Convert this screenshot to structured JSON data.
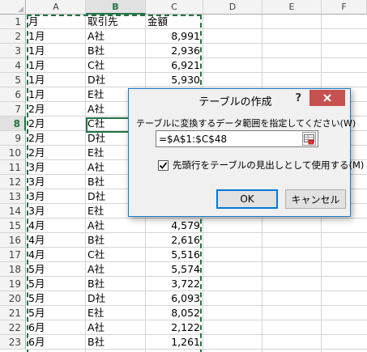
{
  "sheet": {
    "columns": [
      "A",
      "B",
      "C",
      "D",
      "E",
      "F"
    ],
    "selected_column": "B",
    "selected_row": "8",
    "rows": [
      {
        "n": "1",
        "a": "月",
        "b": "取引先",
        "c": "金額"
      },
      {
        "n": "2",
        "a": "1月",
        "b": "A社",
        "c": "8,991"
      },
      {
        "n": "3",
        "a": "1月",
        "b": "B社",
        "c": "2,936"
      },
      {
        "n": "4",
        "a": "1月",
        "b": "C社",
        "c": "6,921"
      },
      {
        "n": "5",
        "a": "1月",
        "b": "D社",
        "c": "5,930"
      },
      {
        "n": "6",
        "a": "1月",
        "b": "E社",
        "c": ""
      },
      {
        "n": "7",
        "a": "2月",
        "b": "A社",
        "c": ""
      },
      {
        "n": "8",
        "a": "2月",
        "b": "C社",
        "c": ""
      },
      {
        "n": "9",
        "a": "2月",
        "b": "D社",
        "c": ""
      },
      {
        "n": "10",
        "a": "2月",
        "b": "E社",
        "c": ""
      },
      {
        "n": "11",
        "a": "3月",
        "b": "A社",
        "c": ""
      },
      {
        "n": "12",
        "a": "3月",
        "b": "B社",
        "c": ""
      },
      {
        "n": "13",
        "a": "3月",
        "b": "D社",
        "c": ""
      },
      {
        "n": "14",
        "a": "3月",
        "b": "E社",
        "c": ""
      },
      {
        "n": "15",
        "a": "4月",
        "b": "A社",
        "c": "4,579"
      },
      {
        "n": "16",
        "a": "4月",
        "b": "B社",
        "c": "2,616"
      },
      {
        "n": "17",
        "a": "4月",
        "b": "C社",
        "c": "5,516"
      },
      {
        "n": "18",
        "a": "5月",
        "b": "A社",
        "c": "5,574"
      },
      {
        "n": "19",
        "a": "5月",
        "b": "B社",
        "c": "3,722"
      },
      {
        "n": "20",
        "a": "5月",
        "b": "D社",
        "c": "6,093"
      },
      {
        "n": "21",
        "a": "5月",
        "b": "E社",
        "c": "8,052"
      },
      {
        "n": "22",
        "a": "6月",
        "b": "A社",
        "c": "2,122"
      },
      {
        "n": "23",
        "a": "6月",
        "b": "B社",
        "c": "1,261"
      }
    ]
  },
  "dialog": {
    "title": "テーブルの作成",
    "help": "?",
    "prompt": "テーブルに変換するデータ範囲を指定してください(W)",
    "range_value": "=$A$1:$C$48",
    "header_checkbox_label": "先頭行をテーブルの見出しとして使用する(M)",
    "header_checkbox_checked": true,
    "ok_label": "OK",
    "cancel_label": "キャンセル"
  },
  "colors": {
    "excel_green": "#217346",
    "close_red": "#c75050",
    "dialog_border": "#1979ca"
  }
}
